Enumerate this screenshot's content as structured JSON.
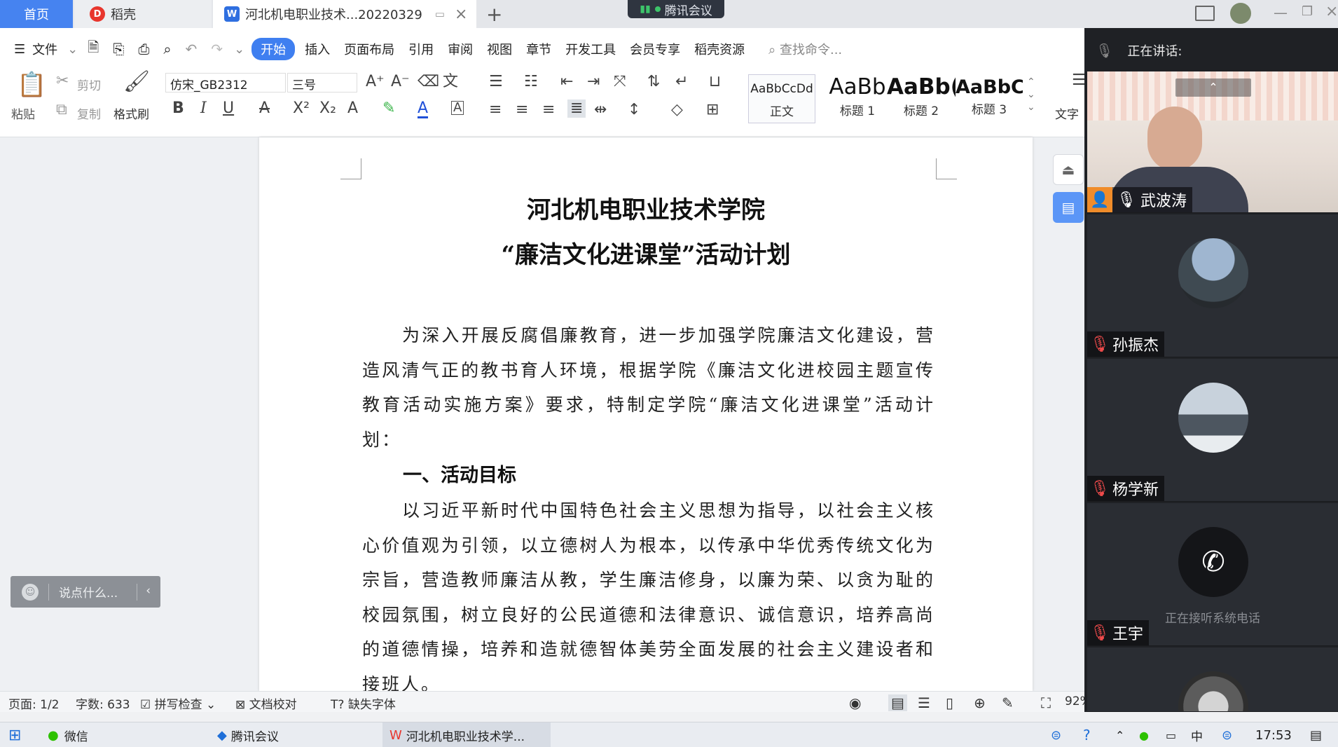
{
  "tabs": {
    "home": "首页",
    "daoke": "稻壳",
    "doc": "河北机电职业技术...20220329"
  },
  "meeting_pill": "腾讯会议",
  "menu": {
    "file": "文件",
    "items": [
      "开始",
      "插入",
      "页面布局",
      "引用",
      "审阅",
      "视图",
      "章节",
      "开发工具",
      "会员专享",
      "稻壳资源"
    ],
    "search_placeholder": "查找命令..."
  },
  "ribbon": {
    "paste": "粘贴",
    "cut": "剪切",
    "copy": "复制",
    "format_painter": "格式刷",
    "font_name": "仿宋_GB2312",
    "font_size": "三号",
    "text_tool": "文字",
    "styles": [
      {
        "sample": "AaBbCcDd",
        "name": "正文"
      },
      {
        "sample": "AaBb",
        "name": "标题 1"
      },
      {
        "sample": "AaBb(",
        "name": "标题 2"
      },
      {
        "sample": "AaBbC",
        "name": "标题 3"
      }
    ]
  },
  "document": {
    "title1": "河北机电职业技术学院",
    "title2": "“廉洁文化进课堂”活动计划",
    "para1": "为深入开展反腐倡廉教育，进一步加强学院廉洁文化建设，营造风清气正的教书育人环境，根据学院《廉洁文化进校园主题宣传教育活动实施方案》要求，特制定学院“廉洁文化进课堂”活动计划：",
    "heading1": "一、活动目标",
    "para2": "以习近平新时代中国特色社会主义思想为指导，以社会主义核心价值观为引领，以立德树人为根本，以传承中华优秀传统文化为宗旨，营造教师廉洁从教，学生廉洁修身，以廉为荣、以贪为耻的校园氛围，树立良好的公民道德和法律意识、诚信意识，培养高尚的道德情操，培养和造就德智体美劳全面发展的社会主义建设者和接班人。"
  },
  "chat_placeholder": "说点什么...",
  "status": {
    "page": "页面: 1/2",
    "words": "字数: 633",
    "spellcheck": "拼写检查",
    "proofread": "文档校对",
    "missing_fonts": "缺失字体",
    "zoom": "92%"
  },
  "meeting": {
    "speaking_label": "正在讲话:",
    "participants": [
      {
        "name": "武波涛",
        "status": ""
      },
      {
        "name": "孙振杰",
        "status": ""
      },
      {
        "name": "杨学新",
        "status": ""
      },
      {
        "name": "王宇",
        "status": "正在接听系统电话"
      }
    ]
  },
  "taskbar": {
    "apps": [
      "微信",
      "腾讯会议",
      "河北机电职业技术学..."
    ],
    "ime": "中",
    "clock": "17:53"
  },
  "colors": {
    "accent": "#3f7ff0",
    "panel_bg": "#1f2125",
    "tile_bg": "#2a2d33"
  }
}
